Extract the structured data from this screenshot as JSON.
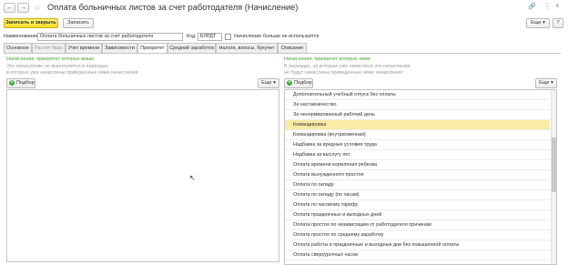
{
  "window": {
    "title": "Оплата больничных листов за счет работодателя (Начисление)",
    "icons": [
      "back-arrow-icon",
      "forward-arrow-icon",
      "star-icon",
      "link-icon",
      "more-vertical-icon",
      "close-icon"
    ]
  },
  "toolbar": {
    "save_close_label": "Записать и закрыть",
    "save_label": "Записать",
    "more_label": "Еще",
    "help_label": "?"
  },
  "form": {
    "name_label": "Наименование:",
    "name_value": "Оплата больничных листов за счет работодателя",
    "code_label": "Код:",
    "code_value": "БЛРДТ",
    "unused_checkbox_label": "Начисление больше не используется",
    "unused_checked": false
  },
  "tabs": [
    {
      "label": "Основное",
      "state": "normal"
    },
    {
      "label": "Расчет базы",
      "state": "disabled"
    },
    {
      "label": "Учет времени",
      "state": "normal"
    },
    {
      "label": "Зависимости",
      "state": "normal"
    },
    {
      "label": "Приоритет",
      "state": "active"
    },
    {
      "label": "Средний заработок",
      "state": "normal"
    },
    {
      "label": "Налоги, взносы, бухучет",
      "state": "normal"
    },
    {
      "label": "Описание",
      "state": "normal"
    }
  ],
  "left_panel": {
    "heading": "Начисления, приоритет которых выше",
    "hint_line1": "Это начисление не выполняется в периодах,",
    "hint_line2": "в которых уже начислены приведенные ниже начисления",
    "add_label": "Подбор",
    "more_label": "Еще",
    "rows": []
  },
  "right_panel": {
    "heading": "Начисления, приоритет которых ниже",
    "hint_line1": "В периодах, за которые уже начислено это начисление,",
    "hint_line2": "не будут начислены приведенные ниже начисления",
    "add_label": "Подбор",
    "more_label": "Еще",
    "selected_index": 3,
    "rows": [
      "Дополнительный учебный отпуск без оплаты",
      "За наставничество",
      "За ненормированный рабочий день",
      "Командировка",
      "Командировка (внутрисменная)",
      "Надбавка за вредные условия труда",
      "Надбавка за выслугу лет",
      "Оплата времени кормления ребенка",
      "Оплата вынужденного простоя",
      "Оплата по окладу",
      "Оплата по окладу (по часам)",
      "Оплата по часовому тарифу",
      "Оплата праздничных и выходных дней",
      "Оплата простоя по независящим от работодателя причинам",
      "Оплата простоя по среднему заработку",
      "Оплата работы в праздничные и выходные дни без повышенной оплаты",
      "Оплата сверхурочных часов"
    ]
  }
}
